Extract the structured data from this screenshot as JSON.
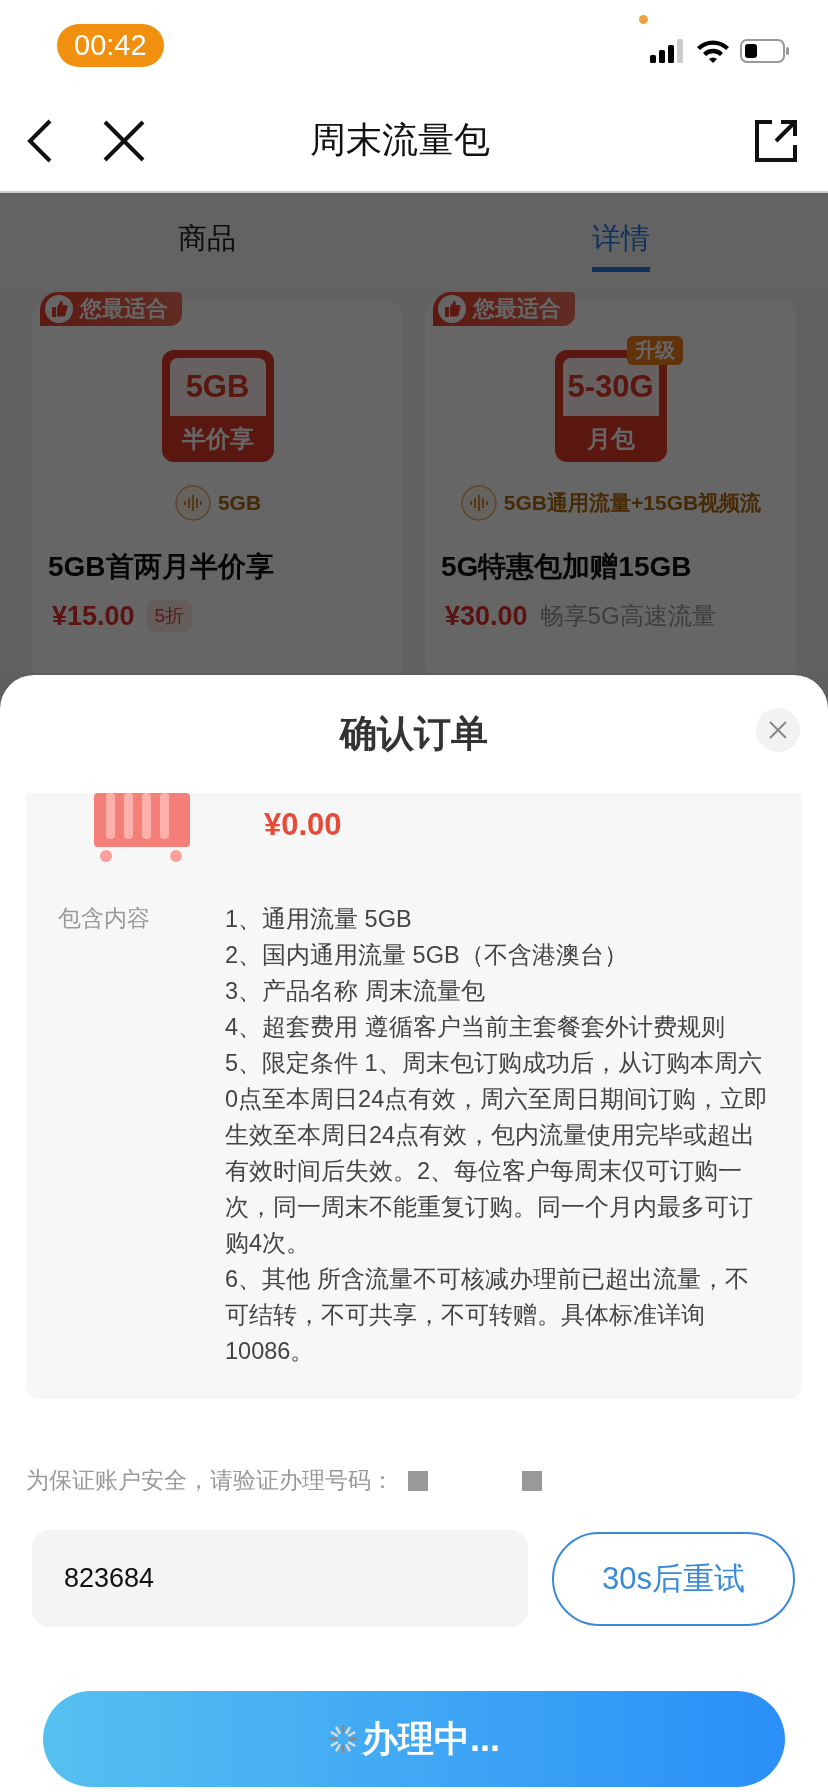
{
  "status_bar": {
    "time": "00:42"
  },
  "nav": {
    "title": "周末流量包"
  },
  "tabs": [
    {
      "label": "商品",
      "selected": false
    },
    {
      "label": "详情",
      "selected": true
    }
  ],
  "products": [
    {
      "badge": "您最适合",
      "art_top": "5GB",
      "art_bottom": "半价享",
      "feature": "5GB",
      "name": "5GB首两月半价享",
      "price": "¥15.00",
      "note": {
        "kind": "discount",
        "text": "5折"
      }
    },
    {
      "badge": "您最适合",
      "art_tag": "升级",
      "art_top": "5-30G",
      "art_bottom": "月包",
      "feature": "5GB通用流量+15GB视频流",
      "name": "5G特惠包加赠15GB",
      "price": "¥30.00",
      "note": {
        "kind": "slogan",
        "text": "畅享5G高速流量"
      }
    }
  ],
  "sheet": {
    "title": "确认订单",
    "price": "¥0.00",
    "details_label": "包含内容",
    "details": [
      "1、通用流量 5GB",
      "2、国内通用流量 5GB（不含港澳台）",
      "3、产品名称  周末流量包",
      "4、超套费用 遵循客户当前主套餐套外计费规则",
      "5、限定条件 1、周末包订购成功后，从订购本周六0点至本周日24点有效，周六至周日期间订购，立即生效至本周日24点有效，包内流量使用完毕或超出有效时间后失效。2、每位客户每周末仅可订购一次，同一周末不能重复订购。同一个月内最多可订购4次。",
      "6、其他 所含流量不可核减办理前已超出流量，不可结转，不可共享，不可转赠。具体标准详询10086。"
    ],
    "verify_prompt": "为保证账户安全，请验证办理号码：",
    "code": "823684",
    "retry": "30s后重试",
    "submit": {
      "label": "办理中...",
      "loading": true
    }
  }
}
